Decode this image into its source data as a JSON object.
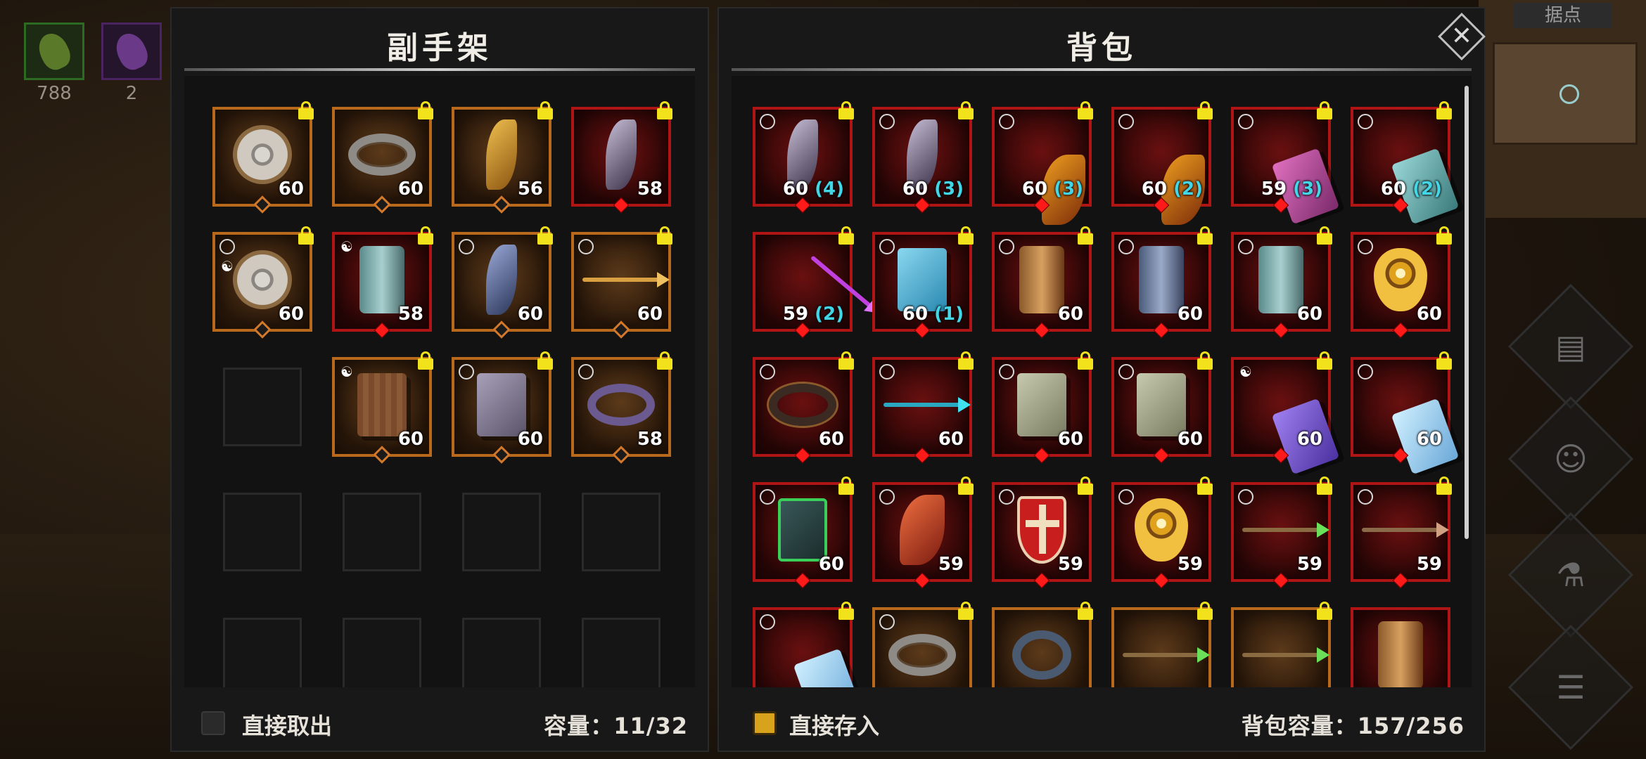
{
  "hud": {
    "slot1_count": "788",
    "slot2_count": "2",
    "minimap_title": "据点"
  },
  "colors": {
    "lock": "#f2e21c",
    "quality_orange": "#b8691c",
    "quality_red": "#b01515",
    "stack_count": "#43d6e6",
    "checkbox_on": "#d8a21c"
  },
  "offhand": {
    "title": "副手架",
    "take_out_label": "直接取出",
    "take_out_checked": false,
    "capacity_label": "容量：11/32",
    "slots": [
      {
        "icon": "round-shield",
        "quality": "orange",
        "level": "60",
        "locked": true
      },
      {
        "icon": "silver-ring",
        "quality": "orange",
        "level": "60",
        "locked": true
      },
      {
        "icon": "golden-claw",
        "quality": "orange",
        "level": "56",
        "locked": true
      },
      {
        "icon": "dark-blade",
        "quality": "red",
        "level": "58",
        "locked": true
      },
      {
        "icon": "round-shield",
        "quality": "orange",
        "level": "60",
        "locked": true,
        "mark": "yinyang"
      },
      {
        "icon": "teal-bracer",
        "quality": "red",
        "level": "58",
        "locked": true,
        "mark": "yinyang"
      },
      {
        "icon": "blue-blade",
        "quality": "orange",
        "level": "60",
        "locked": true
      },
      {
        "icon": "golden-arrow",
        "quality": "orange",
        "level": "60",
        "locked": true
      },
      {
        "empty": true
      },
      {
        "icon": "wooden-book",
        "quality": "orange",
        "level": "60",
        "locked": true,
        "mark": "yinyang"
      },
      {
        "icon": "grey-book",
        "quality": "orange",
        "level": "60",
        "locked": true
      },
      {
        "icon": "purple-ring",
        "quality": "orange",
        "level": "58",
        "locked": true
      },
      {
        "empty": true
      },
      {
        "empty": true
      },
      {
        "empty": true
      },
      {
        "empty": true
      },
      {
        "empty": true
      },
      {
        "empty": true
      },
      {
        "empty": true
      },
      {
        "empty": true
      }
    ]
  },
  "backpack": {
    "title": "背包",
    "store_label": "直接存入",
    "store_checked": true,
    "capacity_label": "背包容量：157/256",
    "slots": [
      {
        "icon": "dark-blade",
        "quality": "red",
        "level": "60",
        "count": "(4)",
        "locked": true
      },
      {
        "icon": "dark-blade",
        "quality": "red",
        "level": "60",
        "count": "(3)",
        "locked": true
      },
      {
        "icon": "flame-shard",
        "quality": "red",
        "level": "60",
        "count": "(3)",
        "locked": true
      },
      {
        "icon": "flame-shard",
        "quality": "red",
        "level": "60",
        "count": "(2)",
        "locked": true
      },
      {
        "icon": "pink-tome",
        "quality": "red",
        "level": "59",
        "count": "(3)",
        "locked": true
      },
      {
        "icon": "teal-tome",
        "quality": "red",
        "level": "60",
        "count": "(2)",
        "locked": true
      },
      {
        "icon": "purple-staff",
        "quality": "red",
        "level": "59",
        "count": "(2)",
        "locked": true,
        "noring": true
      },
      {
        "icon": "blue-book",
        "quality": "red",
        "level": "60",
        "count": "(1)",
        "locked": true
      },
      {
        "icon": "bronze-bracer",
        "quality": "red",
        "level": "60",
        "locked": true
      },
      {
        "icon": "blue-bracer",
        "quality": "red",
        "level": "60",
        "locked": true
      },
      {
        "icon": "teal-bracer",
        "quality": "red",
        "level": "60",
        "locked": true
      },
      {
        "icon": "gold-shield",
        "quality": "red",
        "level": "60",
        "locked": true
      },
      {
        "icon": "dark-ring",
        "quality": "red",
        "level": "60",
        "locked": true
      },
      {
        "icon": "cyan-arrow",
        "quality": "red",
        "level": "60",
        "locked": true
      },
      {
        "icon": "sage-book",
        "quality": "red",
        "level": "60",
        "locked": true
      },
      {
        "icon": "sage-book",
        "quality": "red",
        "level": "60",
        "locked": true
      },
      {
        "icon": "violet-tome",
        "quality": "red",
        "level": "60",
        "locked": true,
        "mark": "yinyang"
      },
      {
        "icon": "ice-tome",
        "quality": "red",
        "level": "60",
        "locked": true
      },
      {
        "icon": "vine-book",
        "quality": "red",
        "level": "60",
        "locked": true
      },
      {
        "icon": "red-claw",
        "quality": "red",
        "level": "59",
        "locked": true
      },
      {
        "icon": "cross-shield",
        "quality": "red",
        "level": "59",
        "locked": true
      },
      {
        "icon": "gold-shield",
        "quality": "red",
        "level": "59",
        "locked": true
      },
      {
        "icon": "green-arrow",
        "quality": "red",
        "level": "59",
        "locked": true
      },
      {
        "icon": "copper-arrow",
        "quality": "red",
        "level": "59",
        "locked": true
      },
      {
        "icon": "ice-tome",
        "quality": "red",
        "level": "",
        "locked": true
      },
      {
        "icon": "silver-ring",
        "quality": "orange",
        "level": "",
        "locked": true
      },
      {
        "icon": "chain-ring",
        "quality": "orange",
        "level": "",
        "locked": true,
        "noring": true
      },
      {
        "icon": "green-arrow",
        "quality": "orange",
        "level": "",
        "locked": true,
        "noring": true
      },
      {
        "icon": "green-arrow",
        "quality": "orange",
        "level": "",
        "locked": true,
        "noring": true
      },
      {
        "icon": "bronze-bracer",
        "quality": "red",
        "level": "",
        "locked": false,
        "noring": true
      }
    ]
  }
}
